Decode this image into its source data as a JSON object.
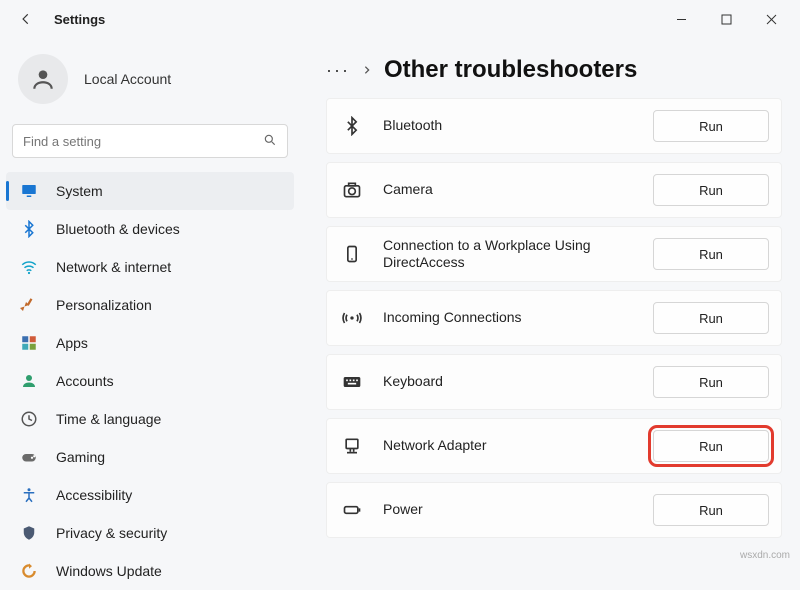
{
  "window": {
    "title": "Settings",
    "minimize_label": "Minimize",
    "maximize_label": "Maximize",
    "close_label": "Close"
  },
  "account": {
    "name": "Local Account"
  },
  "search": {
    "placeholder": "Find a setting"
  },
  "nav": [
    {
      "key": "system",
      "label": "System",
      "active": true,
      "icon_color": "#1976d2"
    },
    {
      "key": "bluetooth-devices",
      "label": "Bluetooth & devices",
      "active": false,
      "icon_color": "#1976d2"
    },
    {
      "key": "network-internet",
      "label": "Network & internet",
      "active": false,
      "icon_color": "#13a3c9"
    },
    {
      "key": "personalization",
      "label": "Personalization",
      "active": false,
      "icon_color": "#c26b2d"
    },
    {
      "key": "apps",
      "label": "Apps",
      "active": false,
      "icon_color": "#3a6fb0"
    },
    {
      "key": "accounts",
      "label": "Accounts",
      "active": false,
      "icon_color": "#2f9e6e"
    },
    {
      "key": "time-language",
      "label": "Time & language",
      "active": false,
      "icon_color": "#555555"
    },
    {
      "key": "gaming",
      "label": "Gaming",
      "active": false,
      "icon_color": "#6b6b6b"
    },
    {
      "key": "accessibility",
      "label": "Accessibility",
      "active": false,
      "icon_color": "#2a6fbf"
    },
    {
      "key": "privacy-security",
      "label": "Privacy & security",
      "active": false,
      "icon_color": "#4b5a73"
    },
    {
      "key": "windows-update",
      "label": "Windows Update",
      "active": false,
      "icon_color": "#d88b2e"
    }
  ],
  "breadcrumb": {
    "more": "···",
    "page_title": "Other troubleshooters"
  },
  "troubleshooters": [
    {
      "key": "bluetooth",
      "label": "Bluetooth",
      "run_label": "Run",
      "highlight": false
    },
    {
      "key": "camera",
      "label": "Camera",
      "run_label": "Run",
      "highlight": false
    },
    {
      "key": "workplace-directaccess",
      "label": "Connection to a Workplace Using DirectAccess",
      "run_label": "Run",
      "highlight": false
    },
    {
      "key": "incoming-connections",
      "label": "Incoming Connections",
      "run_label": "Run",
      "highlight": false
    },
    {
      "key": "keyboard",
      "label": "Keyboard",
      "run_label": "Run",
      "highlight": false
    },
    {
      "key": "network-adapter",
      "label": "Network Adapter",
      "run_label": "Run",
      "highlight": true
    },
    {
      "key": "power",
      "label": "Power",
      "run_label": "Run",
      "highlight": false
    }
  ],
  "watermark": "wsxdn.com",
  "icons": {
    "system": "monitor-icon",
    "bluetooth-devices": "bluetooth-icon",
    "network-internet": "wifi-icon",
    "personalization": "brush-icon",
    "apps": "apps-icon",
    "accounts": "person-icon",
    "time-language": "clock-icon",
    "gaming": "gamepad-icon",
    "accessibility": "accessibility-icon",
    "privacy-security": "shield-icon",
    "windows-update": "update-icon",
    "bluetooth": "bluetooth-icon",
    "camera": "camera-icon",
    "workplace-directaccess": "phone-icon",
    "incoming-connections": "signal-icon",
    "keyboard": "keyboard-icon",
    "network-adapter": "network-adapter-icon",
    "power": "battery-icon"
  }
}
